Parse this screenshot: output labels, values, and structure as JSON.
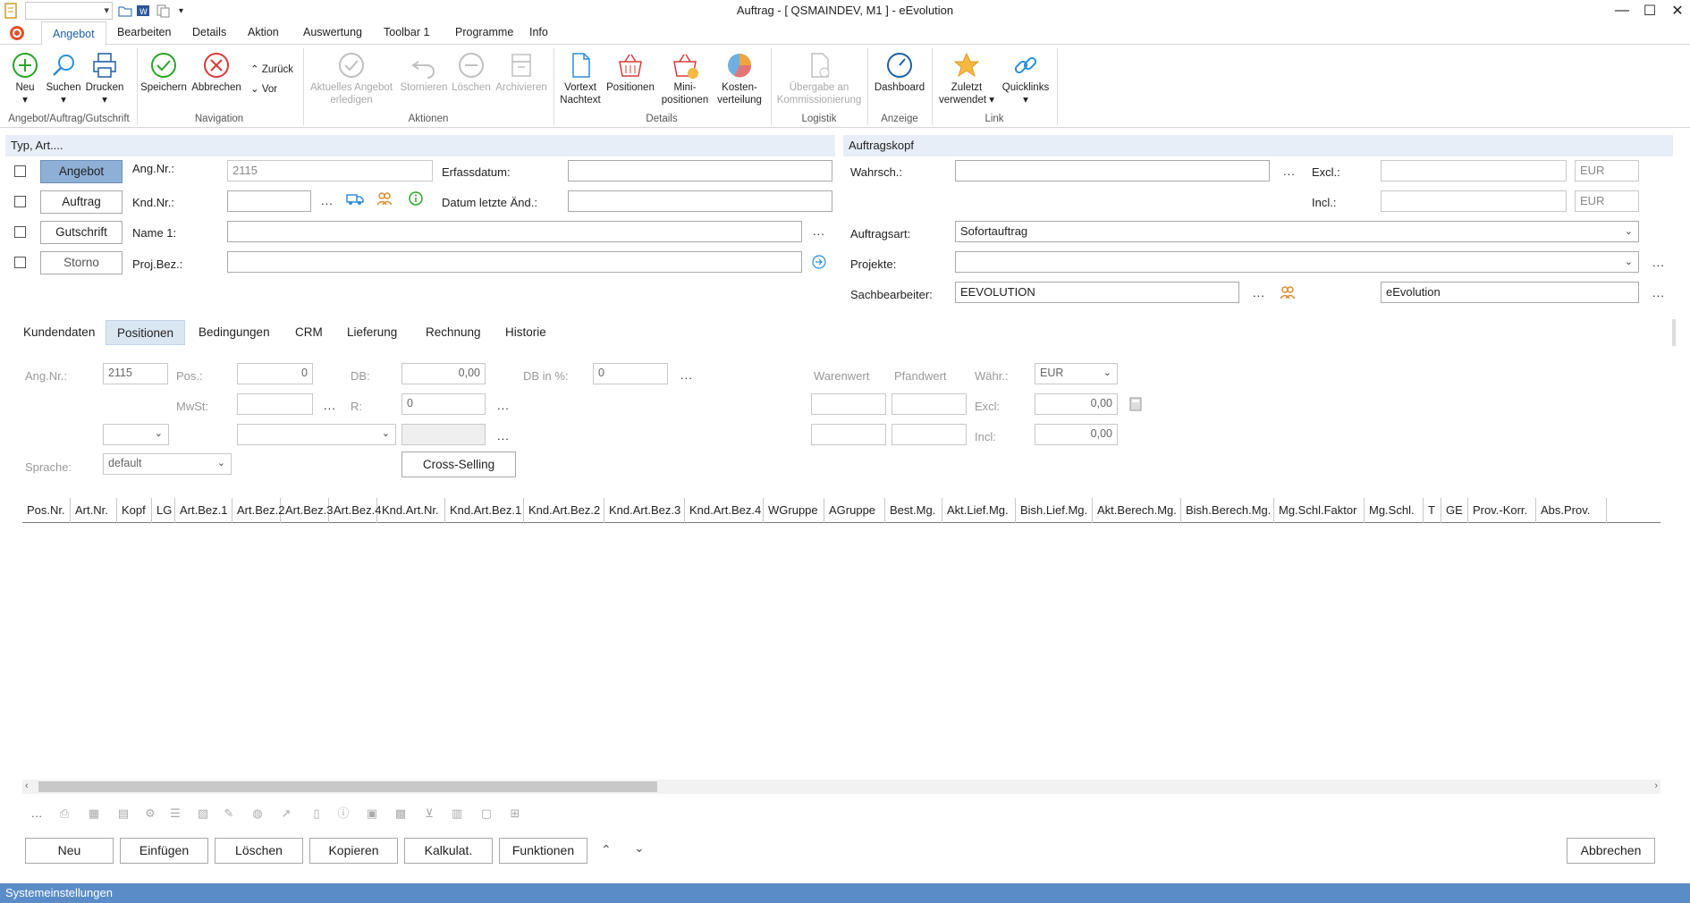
{
  "window": {
    "title": "Auftrag - [ QSMAINDEV, M1 ]  -  eEvolution"
  },
  "ribbon_tabs": [
    "Angebot",
    "Bearbeiten",
    "Details",
    "Aktion",
    "Auswertung",
    "Toolbar 1",
    "Programme",
    "Info"
  ],
  "ribbon": {
    "groups": {
      "angebot": "Angebot/Auftrag/Gutschrift",
      "navigation": "Navigation",
      "aktionen": "Aktionen",
      "details": "Details",
      "logistik": "Logistik",
      "anzeige": "Anzeige",
      "link": "Link"
    },
    "buttons": {
      "neu": "Neu",
      "suchen": "Suchen",
      "drucken": "Drucken",
      "speichern": "Speichern",
      "abbrechen": "Abbrechen",
      "zurueck": "Zurück",
      "vor": "Vor",
      "aktuelles_1": "Aktuelles Angebot",
      "aktuelles_2": "erledigen",
      "stornieren": "Stornieren",
      "loeschen": "Löschen",
      "archivieren": "Archivieren",
      "vortext_1": "Vortext",
      "vortext_2": "Nachtext",
      "positionen": "Positionen",
      "mini_1": "Mini-",
      "mini_2": "positionen",
      "kosten_1": "Kosten-",
      "kosten_2": "verteilung",
      "uebergabe_1": "Übergabe an",
      "uebergabe_2": "Kommissionierung",
      "dashboard": "Dashboard",
      "zuletzt_1": "Zuletzt",
      "zuletzt_2": "verwendet",
      "quicklinks": "Quicklinks"
    }
  },
  "typ": {
    "header": "Typ, Art....",
    "types": [
      "Angebot",
      "Auftrag",
      "Gutschrift",
      "Storno"
    ],
    "labels": {
      "angnr": "Ang.Nr.:",
      "kndnr": "Knd.Nr.:",
      "name1": "Name 1:",
      "projbez": "Proj.Bez.:",
      "erfassdatum": "Erfassdatum:",
      "datum_letzte": "Datum letzte Änd.:"
    },
    "values": {
      "angnr": "2115"
    }
  },
  "auftragskopf": {
    "header": "Auftragskopf",
    "labels": {
      "wahrsch": "Wahrsch.:",
      "excl": "Excl.:",
      "incl": "Incl.:",
      "auftragsart": "Auftragsart:",
      "projekte": "Projekte:",
      "sachbearbeiter": "Sachbearbeiter:"
    },
    "values": {
      "eur1": "EUR",
      "eur2": "EUR",
      "auftragsart": "Sofortauftrag",
      "sachbearbeiter": "EEVOLUTION",
      "sachbearbeiter_name": "eEvolution"
    }
  },
  "detail_tabs": [
    "Kundendaten",
    "Positionen",
    "Bedingungen",
    "CRM",
    "Lieferung",
    "Rechnung",
    "Historie"
  ],
  "positionen": {
    "labels": {
      "angnr": "Ang.Nr.:",
      "pos": "Pos.:",
      "db": "DB:",
      "db_pct": "DB in %:",
      "mwst": "MwSt:",
      "r": "R:",
      "sprache": "Sprache:",
      "warenwert": "Warenwert",
      "pfandwert": "Pfandwert",
      "waehr": "Währ.:",
      "excl": "Excl:",
      "incl": "Incl:"
    },
    "values": {
      "angnr": "2115",
      "pos": "0",
      "db": "0,00",
      "db_pct": "0",
      "r": "0",
      "sprache": "default",
      "waehr": "EUR",
      "excl": "0,00",
      "incl": "0,00"
    },
    "cross_selling": "Cross-Selling"
  },
  "grid": {
    "columns": [
      "Pos.Nr.",
      "Art.Nr.",
      "Kopf",
      "LG",
      "Art.Bez.1",
      "Art.Bez.2",
      "Art.Bez.3",
      "Art.Bez.4",
      "Knd.Art.Nr.",
      "Knd.Art.Bez.1",
      "Knd.Art.Bez.2",
      "Knd.Art.Bez.3",
      "Knd.Art.Bez.4",
      "WGruppe",
      "AGruppe",
      "Best.Mg.",
      "Akt.Lief.Mg.",
      "Bish.Lief.Mg.",
      "Akt.Berech.Mg.",
      "Bish.Berech.Mg.",
      "Mg.Schl.Faktor",
      "Mg.Schl.",
      "T",
      "GE",
      "Prov.-Korr.",
      "Abs.Prov."
    ]
  },
  "bottom_buttons": {
    "neu": "Neu",
    "einfuegen": "Einfügen",
    "loeschen": "Löschen",
    "kopieren": "Kopieren",
    "kalkulat": "Kalkulat.",
    "funktionen": "Funktionen",
    "abbrechen": "Abbrechen"
  },
  "status": {
    "text": "Systemeinstellungen"
  },
  "colors": {
    "accent": "#5a8cc8",
    "selected_type": "#8fb0d6",
    "section_header": "#e8eef7"
  }
}
